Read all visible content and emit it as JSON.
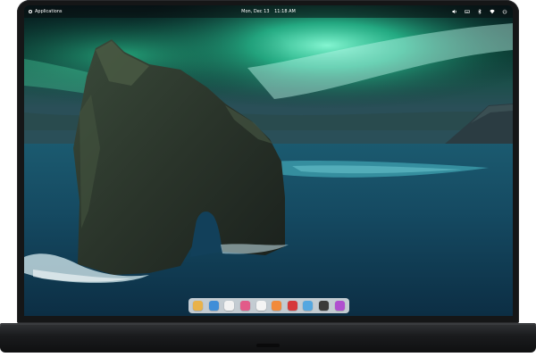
{
  "top_panel": {
    "applications_label": "Applications",
    "clock_day": "Mon, Dec 13",
    "clock_time": "11:18 AM"
  },
  "indicators": [
    {
      "icon": "volume-icon"
    },
    {
      "icon": "keyboard-icon"
    },
    {
      "icon": "bluetooth-icon"
    },
    {
      "icon": "network-icon"
    },
    {
      "icon": "power-icon"
    }
  ],
  "dock": {
    "apps": [
      {
        "name": "files",
        "color": "#e9b24a"
      },
      {
        "name": "web-browser",
        "color": "#3f8ed8"
      },
      {
        "name": "mail",
        "color": "#f2f2f2"
      },
      {
        "name": "tasks",
        "color": "#e25b89"
      },
      {
        "name": "calendar",
        "color": "#f4f4f4"
      },
      {
        "name": "music",
        "color": "#f28a3b"
      },
      {
        "name": "videos",
        "color": "#d6383a"
      },
      {
        "name": "photos",
        "color": "#55a7e0"
      },
      {
        "name": "terminal",
        "color": "#3a3a3a"
      },
      {
        "name": "appcenter",
        "color": "#b04fcf"
      }
    ]
  }
}
